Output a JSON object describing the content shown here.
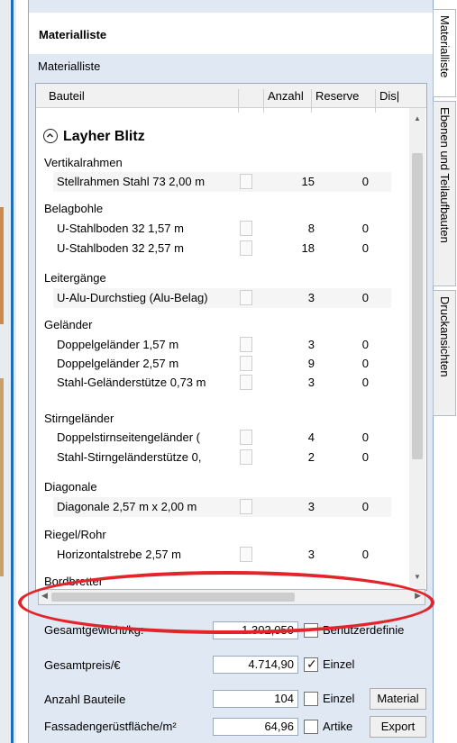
{
  "panel": {
    "title": "Materialliste",
    "section": "Materialliste"
  },
  "columns": {
    "bauteil": "Bauteil",
    "anzahl": "Anzahl",
    "reserve": "Reserve",
    "disp": "Dis|"
  },
  "group": {
    "name": "Layher Blitz",
    "collapse_icon": "chevron-up-circle-icon"
  },
  "categories": [
    {
      "name": "Vertikalrahmen",
      "rows": [
        {
          "name": "Stellrahmen Stahl 73 2,00 m",
          "anzahl": "15",
          "reserve": "0"
        }
      ]
    },
    {
      "name": "Belagbohle",
      "rows": [
        {
          "name": "U-Stahlboden 32 1,57 m",
          "anzahl": "8",
          "reserve": "0"
        },
        {
          "name": "U-Stahlboden 32 2,57 m",
          "anzahl": "18",
          "reserve": "0"
        }
      ]
    },
    {
      "name": "Leitergänge",
      "rows": [
        {
          "name": "U-Alu-Durchstieg (Alu-Belag)",
          "anzahl": "3",
          "reserve": "0"
        }
      ]
    },
    {
      "name": "Geländer",
      "rows": [
        {
          "name": "Doppelgeländer 1,57 m",
          "anzahl": "3",
          "reserve": "0"
        },
        {
          "name": "Doppelgeländer 2,57 m",
          "anzahl": "9",
          "reserve": "0"
        },
        {
          "name": "Stahl-Geländerstütze 0,73 m",
          "anzahl": "3",
          "reserve": "0"
        }
      ]
    },
    {
      "name": "Stirngeländer",
      "rows": [
        {
          "name": "Doppelstirnseitengeländer (",
          "anzahl": "4",
          "reserve": "0"
        },
        {
          "name": "Stahl-Stirngeländerstütze 0,",
          "anzahl": "2",
          "reserve": "0"
        }
      ]
    },
    {
      "name": "Diagonale",
      "rows": [
        {
          "name": "Diagonale 2,57 m x 2,00 m",
          "anzahl": "3",
          "reserve": "0"
        }
      ]
    },
    {
      "name": "Riegel/Rohr",
      "rows": [
        {
          "name": "Horizontalstrebe 2,57 m",
          "anzahl": "3",
          "reserve": "0"
        }
      ]
    },
    {
      "name": "Bordbretter",
      "rows": []
    }
  ],
  "summary": {
    "gewicht_label": "Gesamtgewicht/kg:",
    "gewicht_value": "1.302,050",
    "gewicht_check": "Benutzerdefinie",
    "preis_label": "Gesamtpreis/€",
    "preis_value": "4.714,90",
    "preis_check": "Einzel",
    "anzahl_label": "Anzahl Bauteile",
    "anzahl_value": "104",
    "anzahl_check": "Einzel",
    "anzahl_button": "Material",
    "flaeche_label": "Fassadengerüstfläche/m²",
    "flaeche_value": "64,96",
    "flaeche_check": "Artike",
    "flaeche_button": "Export"
  },
  "tabs": [
    "Materialliste",
    "Ebenen und Teilaufbauten",
    "Druckansichten"
  ],
  "colors": {
    "panel_bg": "#dfe8f3",
    "highlight_ellipse": "#e3242b"
  }
}
